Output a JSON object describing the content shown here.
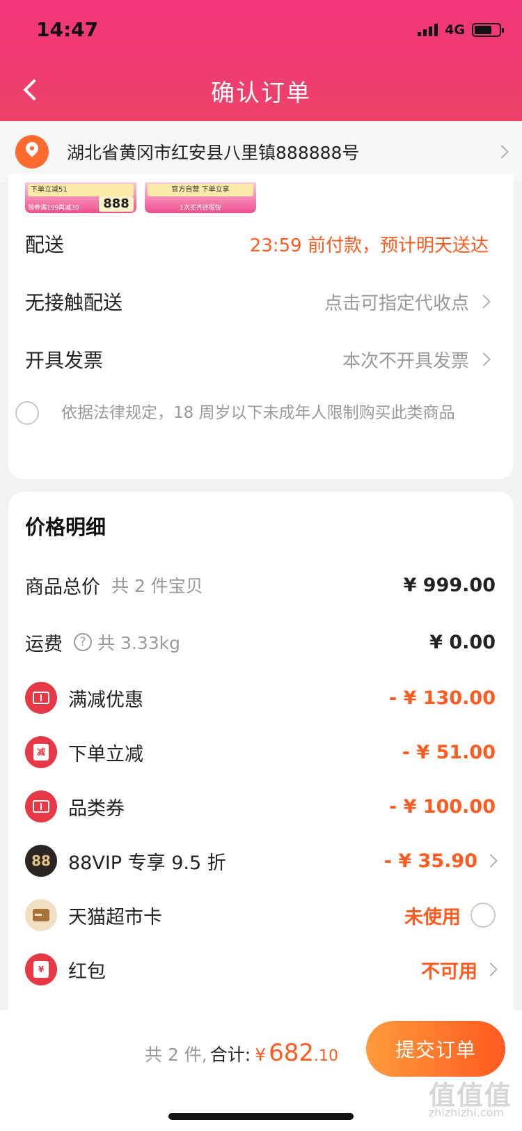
{
  "status_bar": {
    "time": "14:47",
    "network": "4G"
  },
  "header": {
    "title": "确认订单"
  },
  "address": {
    "text": "湖北省黄冈市红安县八里镇888888号"
  },
  "promos": [
    {
      "line1": "下单立减51",
      "line2": "领券满199再减30",
      "price": "888"
    },
    {
      "line1": "官方自营 下单立享",
      "line2": "1次买齐还很快"
    }
  ],
  "order_rows": {
    "delivery": {
      "label": "配送",
      "value": "23:59 前付款，预计明天送达"
    },
    "contactless": {
      "label": "无接触配送",
      "value": "点击可指定代收点"
    },
    "invoice": {
      "label": "开具发票",
      "value": "本次不开具发票"
    },
    "consent": "依据法律规定，18 周岁以下未成年人限制购买此类商品"
  },
  "price_detail": {
    "title": "价格明细",
    "goods_total": {
      "label": "商品总价",
      "sub": "共 2 件宝贝",
      "value": "¥ 999.00"
    },
    "shipping": {
      "label": "运费",
      "help": "?",
      "sub": "共 3.33kg",
      "value": "¥ 0.00"
    },
    "items": [
      {
        "label": "满减优惠",
        "value": "- ¥ 130.00"
      },
      {
        "label": "下单立减",
        "value": "- ¥ 51.00",
        "icon_text": "减"
      },
      {
        "label": "品类券",
        "value": "- ¥ 100.00"
      },
      {
        "label": "88VIP 专享 9.5 折",
        "value": "- ¥ 35.90",
        "icon_text": "88"
      },
      {
        "label": "天猫超市卡",
        "value": "未使用"
      },
      {
        "label": "红包",
        "value": "不可用",
        "icon_text": "¥"
      }
    ]
  },
  "footer": {
    "count": "共 2 件,",
    "total_label": "合计:",
    "currency": "¥",
    "total_int": "682",
    "total_dec": ".10",
    "submit": "提交订单",
    "watermark": "值值值",
    "watermark_sub": "zhizhizhi.com"
  },
  "colors": {
    "brand_pink": "#f4367c",
    "accent_orange": "#ff5a1f",
    "coupon_red": "#e63945"
  }
}
